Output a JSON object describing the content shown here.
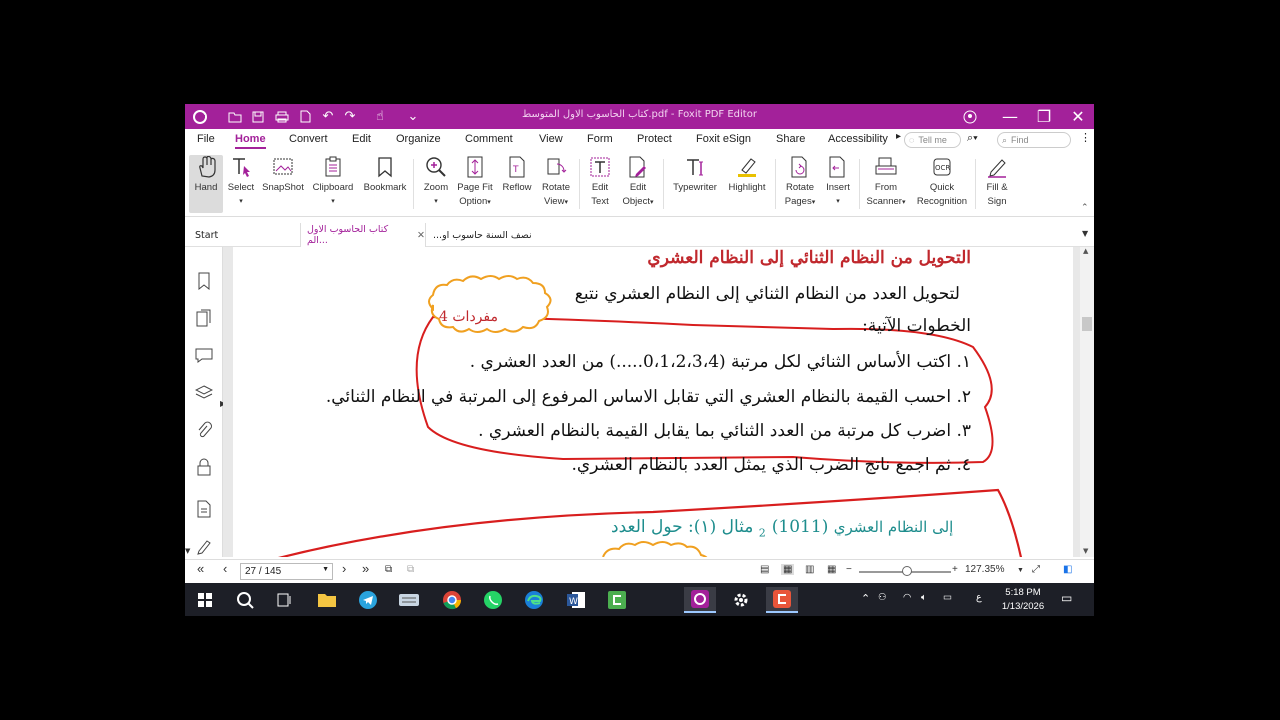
{
  "window": {
    "title": "كتاب الحاسوب الاول المتوسط.pdf - Foxit PDF Editor",
    "accent": "#a3219a"
  },
  "menu": [
    "File",
    "Home",
    "Convert",
    "Edit",
    "Organize",
    "Comment",
    "View",
    "Form",
    "Protect",
    "Foxit eSign",
    "Share",
    "Accessibility"
  ],
  "menu_active": "Home",
  "tell_me": "Tell me",
  "find": "Find",
  "ribbon": {
    "hand": "Hand",
    "select": "Select",
    "snapshot": "SnapShot",
    "clipboard": "Clipboard",
    "bookmark": "Bookmark",
    "zoom": "Zoom",
    "page_fit_1": "Page Fit",
    "page_fit_2": "Option",
    "reflow": "Reflow",
    "rotate_view_1": "Rotate",
    "rotate_view_2": "View",
    "edit_text_1": "Edit",
    "edit_text_2": "Text",
    "edit_object_1": "Edit",
    "edit_object_2": "Object",
    "typewriter": "Typewriter",
    "highlight": "Highlight",
    "rotate_pages_1": "Rotate",
    "rotate_pages_2": "Pages",
    "insert": "Insert",
    "from_scanner_1": "From",
    "from_scanner_2": "Scanner",
    "quick_rec_1": "Quick",
    "quick_rec_2": "Recognition",
    "fill_sign_1": "Fill &",
    "fill_sign_2": "Sign"
  },
  "tabs": {
    "start": "Start",
    "doc1": "كتاب الحاسوب الاول الم...",
    "doc2": "...نصف السنة حاسوب او"
  },
  "page": {
    "heading": "التحويل من النظام الثنائي إلى النظام العشري",
    "intro": "لتحويل  العدد من النظام الثنائي  إلى النظام العشري  نتبع",
    "steps_label": "الخطوات الآتية:",
    "cloud_label": "مفردات 4",
    "step1": "١. اكتب الأساس الثنائي لكل مرتبة (0،1،2،3،4.....) من العدد العشري .",
    "step2": "٢. احسب القيمة بالنظام العشري التي تقابل الاساس المرفوع إلى المرتبة في النظام الثنائي.",
    "step3": "٣. اضرب كل مرتبة من العدد الثنائي بما يقابل القيمة بالنظام العشري .",
    "step4": "٤. ثم اجمع ناتج الضرب الذي يمثل العدد بالنظام العشري.",
    "example_prefix": "مثال (١):  حول العدد",
    "example_number": "(1011)",
    "example_sub": "2",
    "example_suffix": "إلى النظام العشري"
  },
  "status": {
    "page": "27 / 145",
    "zoom": "127.35%"
  },
  "taskbar": {
    "time": "5:18 PM",
    "date": "1/13/2026",
    "lang": "ع"
  }
}
